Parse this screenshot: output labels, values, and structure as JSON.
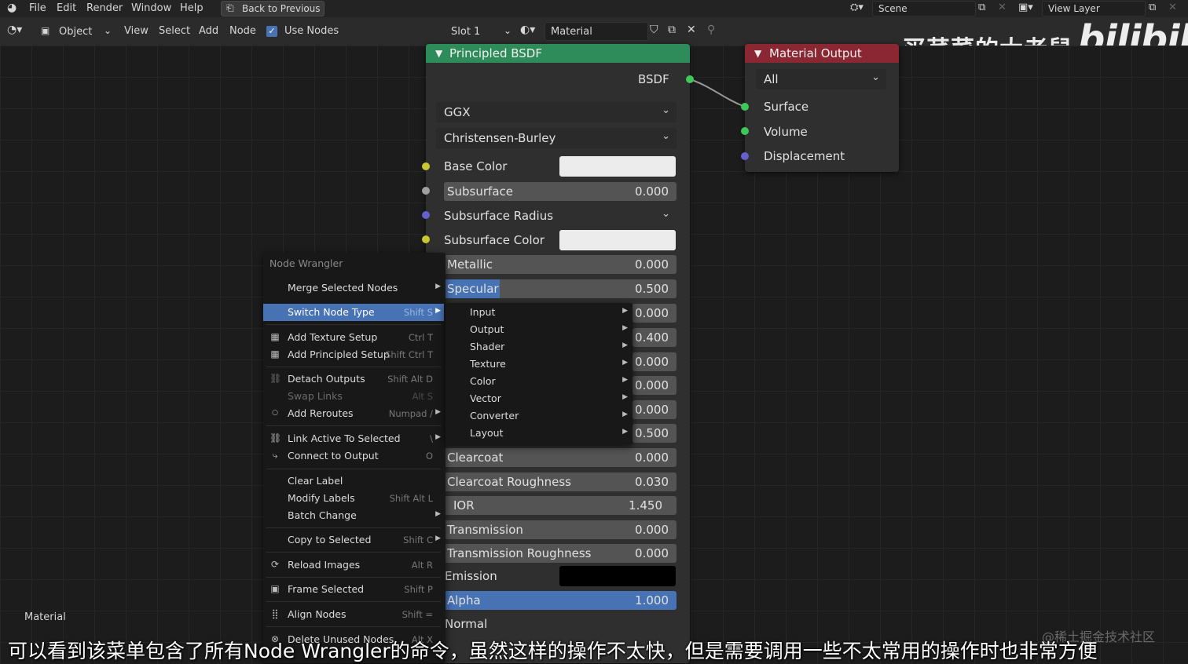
{
  "top_menu": {
    "file": "File",
    "edit": "Edit",
    "render": "Render",
    "window": "Window",
    "help": "Help",
    "back": "Back to Previous",
    "scene": "Scene",
    "view_layer": "View Layer"
  },
  "header": {
    "mode": "Object",
    "view": "View",
    "select": "Select",
    "add": "Add",
    "node": "Node",
    "use_nodes": "Use Nodes",
    "slot": "Slot 1",
    "material": "Material"
  },
  "watermark": {
    "name": "买芹菜的大老鼠",
    "logo": "bilibili",
    "corner": "@稀土掘金技术社区"
  },
  "principled": {
    "title": "Principled BSDF",
    "bsdf_output": "BSDF",
    "distribution": "GGX",
    "subsurface_method": "Christensen-Burley",
    "base_color": "Base Color",
    "subsurface": {
      "label": "Subsurface",
      "value": "0.000"
    },
    "subsurface_radius": "Subsurface Radius",
    "subsurface_color": "Subsurface Color",
    "metallic": {
      "label": "Metallic",
      "value": "0.000"
    },
    "specular": {
      "label": "Specular",
      "value": "0.500",
      "fraction": 0.5
    },
    "hidden_values": [
      "0.000",
      "0.400",
      "0.000",
      "0.000",
      "0.000",
      "0.500"
    ],
    "clearcoat": {
      "label": "Clearcoat",
      "value": "0.000"
    },
    "clearcoat_roughness": {
      "label": "Clearcoat Roughness",
      "value": "0.030"
    },
    "ior": {
      "label": "IOR",
      "value": "1.450"
    },
    "transmission": {
      "label": "Transmission",
      "value": "0.000"
    },
    "transmission_roughness": {
      "label": "Transmission Roughness",
      "value": "0.000"
    },
    "emission": "Emission",
    "alpha": {
      "label": "Alpha",
      "value": "1.000",
      "fraction": 1.0
    },
    "normal": "Normal"
  },
  "material_output": {
    "title": "Material Output",
    "target": "All",
    "surface": "Surface",
    "volume": "Volume",
    "displacement": "Displacement"
  },
  "menu": {
    "title": "Node Wrangler",
    "items": [
      {
        "label": "Merge Selected Nodes",
        "key": ""
      },
      {
        "label": "Switch Node Type",
        "key": "Shift S"
      },
      {
        "label": "Add Texture Setup",
        "key": "Ctrl T"
      },
      {
        "label": "Add Principled Setup",
        "key": "Shift Ctrl T"
      },
      {
        "label": "Detach Outputs",
        "key": "Shift Alt D"
      },
      {
        "label": "Swap Links",
        "key": "Alt S"
      },
      {
        "label": "Add Reroutes",
        "key": "Numpad /"
      },
      {
        "label": "Link Active To Selected",
        "key": "\\"
      },
      {
        "label": "Connect to Output",
        "key": "O"
      },
      {
        "label": "Clear Label",
        "key": ""
      },
      {
        "label": "Modify Labels",
        "key": "Shift Alt L"
      },
      {
        "label": "Batch Change",
        "key": ""
      },
      {
        "label": "Copy to Selected",
        "key": "Shift C"
      },
      {
        "label": "Reload Images",
        "key": "Alt R"
      },
      {
        "label": "Frame Selected",
        "key": "Shift P"
      },
      {
        "label": "Align Nodes",
        "key": "Shift ="
      },
      {
        "label": "Delete Unused Nodes",
        "key": "Alt X"
      }
    ]
  },
  "submenu": [
    "Input",
    "Output",
    "Shader",
    "Texture",
    "Color",
    "Vector",
    "Converter",
    "Layout"
  ],
  "bottom_label": "Material",
  "subtitle": "可以看到该菜单包含了所有Node Wrangler的命令，虽然这样的操作不太快，但是需要调用一些不太常用的操作时也非常方便",
  "colors": {
    "principled_header": "#2e8b5a",
    "output_header": "#8b2733",
    "highlight": "#4772b3"
  }
}
